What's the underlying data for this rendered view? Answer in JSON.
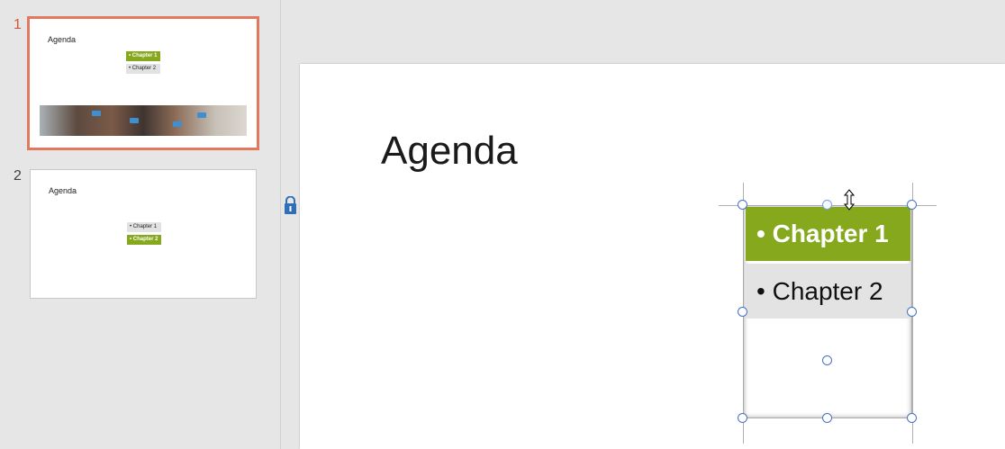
{
  "thumbnails": [
    {
      "number": "1",
      "title": "Agenda",
      "items": [
        "• Chapter 1",
        "• Chapter 2"
      ],
      "highlighted_index": 0,
      "has_photo": true,
      "selected": true
    },
    {
      "number": "2",
      "title": "Agenda",
      "items": [
        "• Chapter 1",
        "• Chapter 2"
      ],
      "highlighted_index": 1,
      "has_photo": false,
      "selected": false
    }
  ],
  "slide": {
    "title": "Agenda",
    "items": [
      "Chapter 1",
      "Chapter 2"
    ],
    "bullet": "•"
  },
  "colors": {
    "accent_green": "#86a81c",
    "selected_outline": "#e0795d",
    "handle_blue": "#4472c4"
  },
  "icons": {
    "resize": "vertical-resize-cursor-icon",
    "lock": "lock-anchor-icon"
  }
}
